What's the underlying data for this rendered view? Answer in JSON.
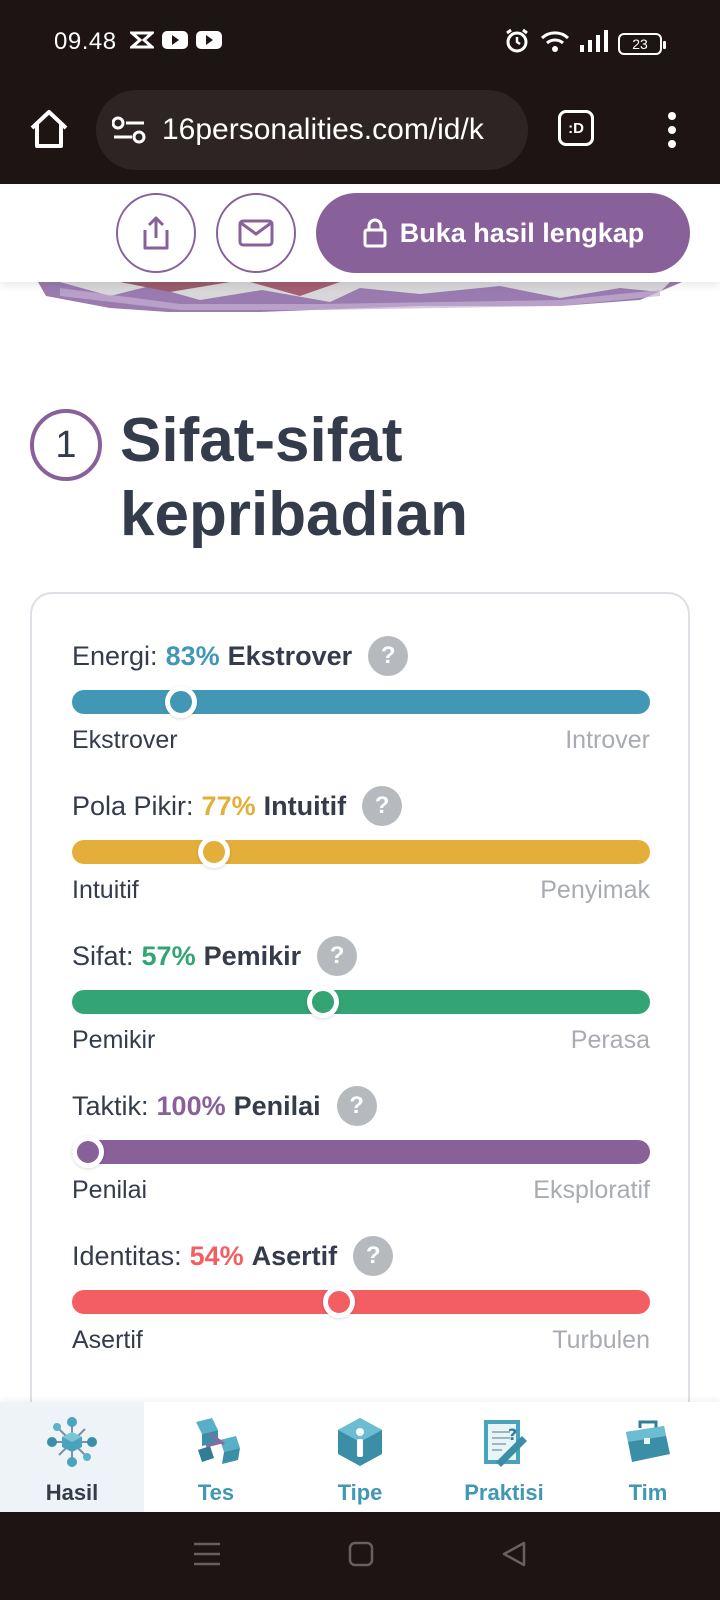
{
  "status_bar": {
    "time": "09.48",
    "battery": "23"
  },
  "browser": {
    "url": "16personalities.com/id/k",
    "tab_label": ":D"
  },
  "actions": {
    "unlock_label": "Buka hasil lengkap"
  },
  "section": {
    "number": "1",
    "title": "Sifat-sifat kepribadian"
  },
  "traits": [
    {
      "label": "Energi:",
      "percent": "83%",
      "result": "Ekstrover",
      "left_pole": "Ekstrover",
      "right_pole": "Introver",
      "color": "#4298b4",
      "position": 0.17
    },
    {
      "label": "Pola Pikir:",
      "percent": "77%",
      "result": "Intuitif",
      "left_pole": "Intuitif",
      "right_pole": "Penyimak",
      "color": "#e4ae3a",
      "position": 0.23
    },
    {
      "label": "Sifat:",
      "percent": "57%",
      "result": "Pemikir",
      "left_pole": "Pemikir",
      "right_pole": "Perasa",
      "color": "#33a474",
      "position": 0.43
    },
    {
      "label": "Taktik:",
      "percent": "100%",
      "result": "Penilai",
      "left_pole": "Penilai",
      "right_pole": "Eksploratif",
      "color": "#88619a",
      "position": 0.0
    },
    {
      "label": "Identitas:",
      "percent": "54%",
      "result": "Asertif",
      "left_pole": "Asertif",
      "right_pole": "Turbulen",
      "color": "#f25e62",
      "position": 0.46
    }
  ],
  "help_icon_text": "?",
  "bottom_nav": [
    {
      "label": "Hasil",
      "icon": "results-molecule-icon",
      "active": true
    },
    {
      "label": "Tes",
      "icon": "test-cubes-icon",
      "active": false
    },
    {
      "label": "Tipe",
      "icon": "info-badge-icon",
      "active": false
    },
    {
      "label": "Praktisi",
      "icon": "notepad-pencil-icon",
      "active": false
    },
    {
      "label": "Tim",
      "icon": "briefcase-icon",
      "active": false
    }
  ],
  "colors": {
    "accent": "#88619a",
    "dark": "#343c4b",
    "nav_label": "#4198b2",
    "system_bar": "#1e1414"
  }
}
